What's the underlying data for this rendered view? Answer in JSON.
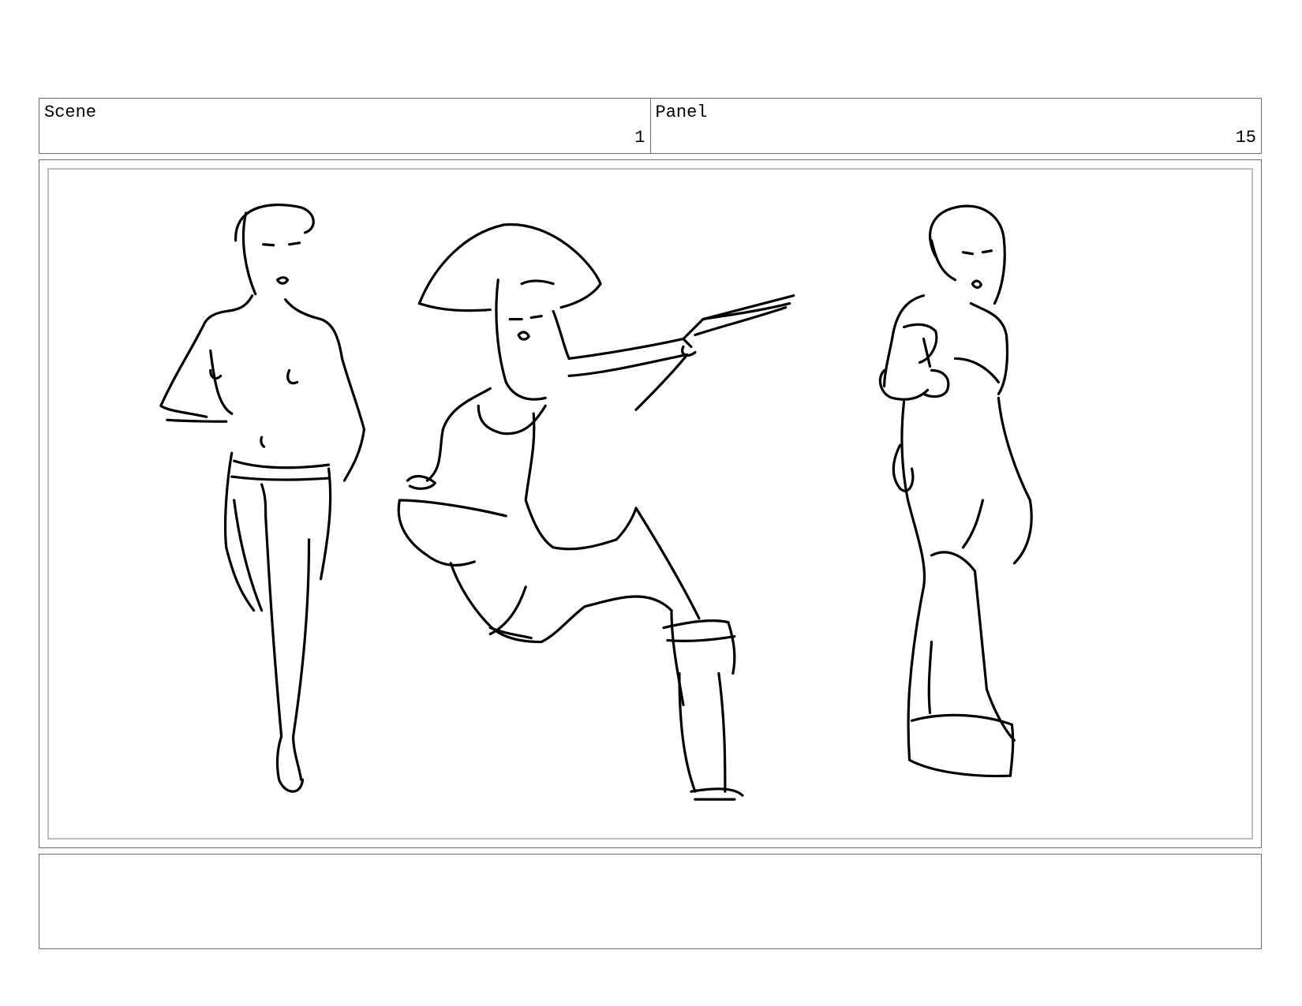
{
  "header": {
    "scene_label": "Scene",
    "scene_number": "1",
    "panel_label": "Panel",
    "panel_number": "15"
  },
  "frame": {
    "figures": [
      "standing-figure-left",
      "crouching-figure-with-pistol",
      "standing-figure-right"
    ]
  },
  "caption": {
    "text": ""
  }
}
